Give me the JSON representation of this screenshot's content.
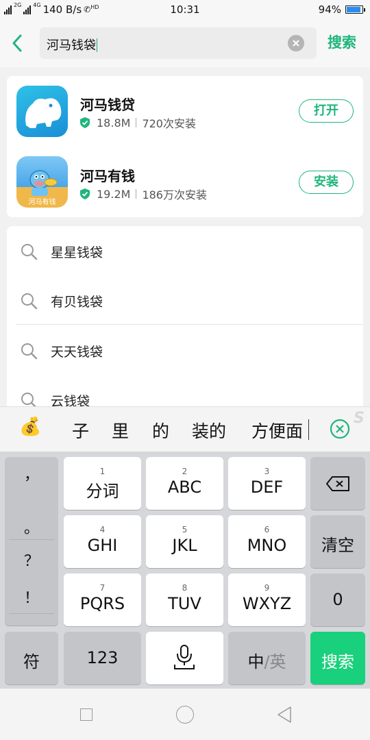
{
  "status_bar": {
    "net_left": "2G",
    "net_right": "4G",
    "speed": "140 B/s",
    "hd": "HD",
    "time": "10:31",
    "battery": "94%",
    "battery_level": 0.94
  },
  "header": {
    "query": "河马钱袋",
    "search_label": "搜索"
  },
  "apps": [
    {
      "name": "河马钱贷",
      "size": "18.8M",
      "installs": "720次安装",
      "action": "打开"
    },
    {
      "name": "河马有钱",
      "size": "19.2M",
      "installs": "186万次安装",
      "action": "安装",
      "icon_caption": "河马有钱"
    }
  ],
  "suggestions": [
    "星星钱袋",
    "有贝钱袋",
    "天天钱袋",
    "云钱袋"
  ],
  "candidates": [
    "子",
    "里",
    "的",
    "装的",
    "方便面"
  ],
  "brand_mark": "S",
  "keyboard": {
    "punct": [
      "，",
      "。",
      "？",
      "！"
    ],
    "keys": [
      {
        "num": "1",
        "label": "分词"
      },
      {
        "num": "2",
        "label": "ABC"
      },
      {
        "num": "3",
        "label": "DEF"
      },
      {
        "num": "4",
        "label": "GHI"
      },
      {
        "num": "5",
        "label": "JKL"
      },
      {
        "num": "6",
        "label": "MNO"
      },
      {
        "num": "7",
        "label": "PQRS"
      },
      {
        "num": "8",
        "label": "TUV"
      },
      {
        "num": "9",
        "label": "WXYZ"
      }
    ],
    "clear_label": "清空",
    "zero_label": "0",
    "symbol_label": "符",
    "num_label": "123",
    "lang_zh": "中",
    "lang_slash": "/",
    "lang_en": "英",
    "enter_label": "搜索"
  },
  "colors": {
    "accent": "#1fb57c",
    "enter": "#19d07c"
  }
}
